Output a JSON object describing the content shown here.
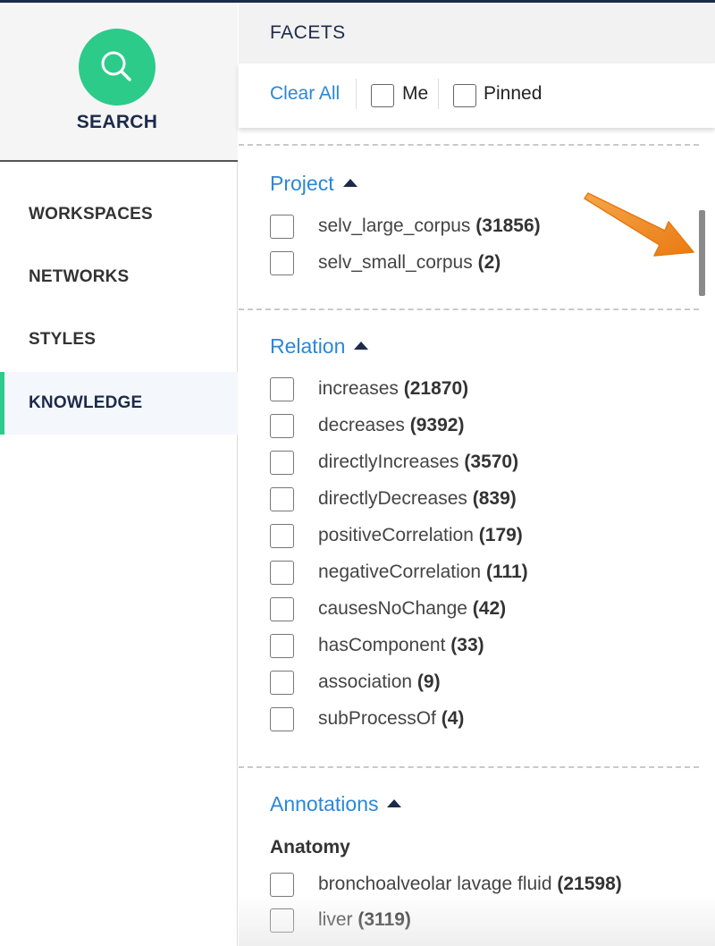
{
  "sidebar": {
    "search_label": "SEARCH",
    "items": [
      {
        "label": "WORKSPACES"
      },
      {
        "label": "NETWORKS"
      },
      {
        "label": "STYLES"
      },
      {
        "label": "KNOWLEDGE",
        "active": true
      }
    ]
  },
  "facets": {
    "title": "FACETS",
    "clear_all": "Clear All",
    "me_label": "Me",
    "pinned_label": "Pinned"
  },
  "sections": {
    "project": {
      "title": "Project",
      "items": [
        {
          "label": "selv_large_corpus",
          "count": "(31856)"
        },
        {
          "label": "selv_small_corpus",
          "count": "(2)"
        }
      ]
    },
    "relation": {
      "title": "Relation",
      "items": [
        {
          "label": "increases",
          "count": "(21870)"
        },
        {
          "label": "decreases",
          "count": "(9392)"
        },
        {
          "label": "directlyIncreases",
          "count": "(3570)"
        },
        {
          "label": "directlyDecreases",
          "count": "(839)"
        },
        {
          "label": "positiveCorrelation",
          "count": "(179)"
        },
        {
          "label": "negativeCorrelation",
          "count": "(111)"
        },
        {
          "label": "causesNoChange",
          "count": "(42)"
        },
        {
          "label": "hasComponent",
          "count": "(33)"
        },
        {
          "label": "association",
          "count": "(9)"
        },
        {
          "label": "subProcessOf",
          "count": "(4)"
        }
      ]
    },
    "annotations": {
      "title": "Annotations",
      "subheading": "Anatomy",
      "items": [
        {
          "label": "bronchoalveolar lavage fluid",
          "count": "(21598)"
        },
        {
          "label": "liver",
          "count": "(3119)"
        }
      ]
    }
  },
  "colors": {
    "accent_green": "#2ccb8a",
    "link_blue": "#2b87d8",
    "navy": "#1d2a4a",
    "annotation_arrow": "#f08a1c"
  },
  "icons": {
    "search": "search-icon",
    "caret": "caret-up-icon",
    "annotation": "orange-arrow-icon"
  }
}
